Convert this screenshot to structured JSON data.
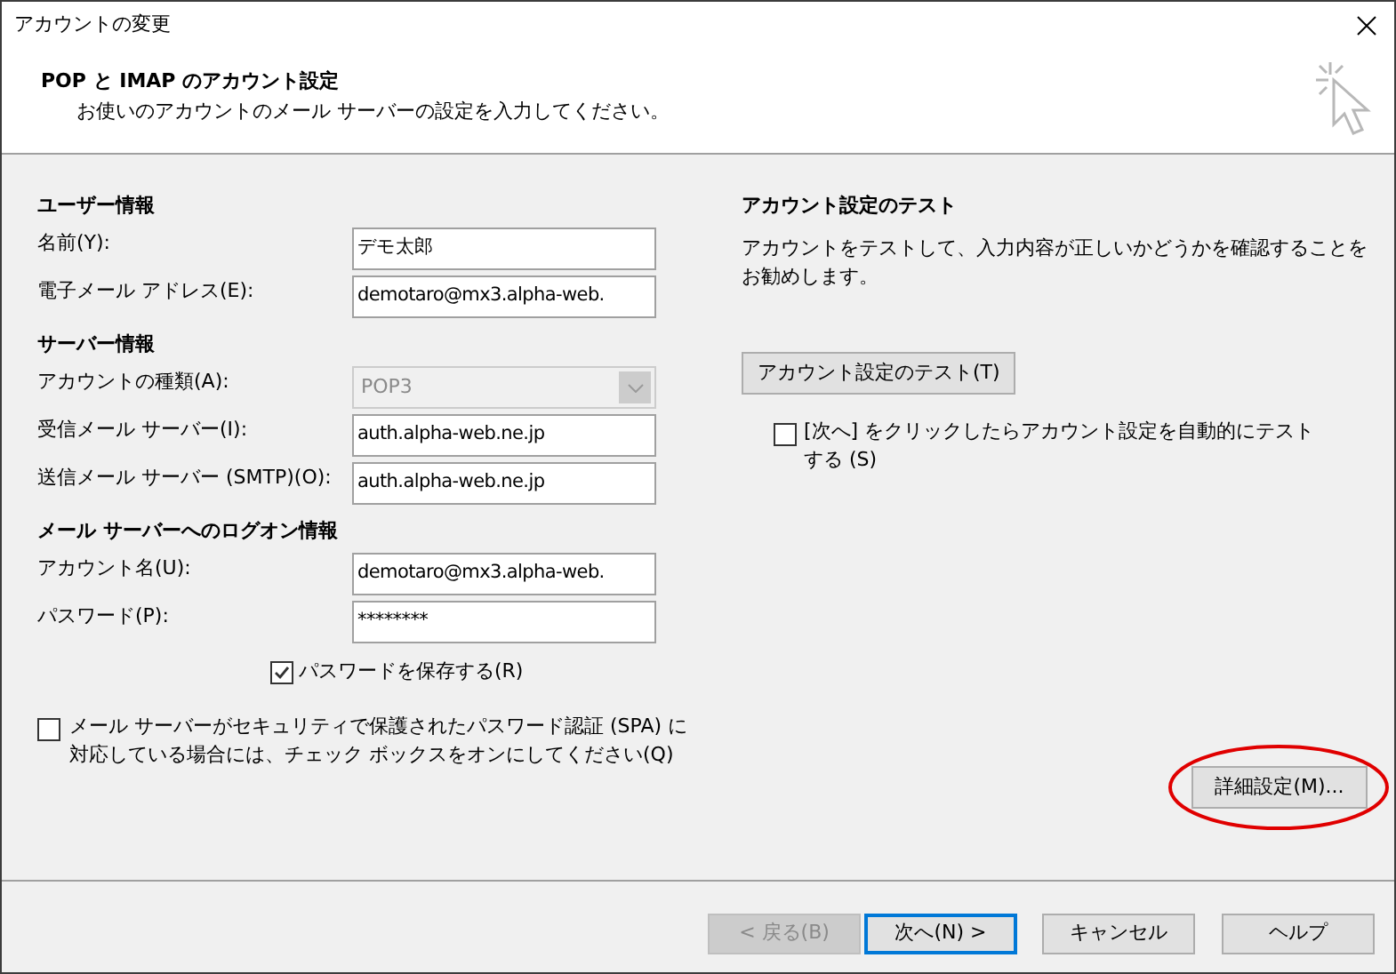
{
  "window": {
    "title": "アカウントの変更"
  },
  "header": {
    "title": "POP と IMAP のアカウント設定",
    "subtitle": "お使いのアカウントのメール サーバーの設定を入力してください。"
  },
  "sections": [
    {
      "title": "ユーザー情報",
      "fields": [
        {
          "kind": "text",
          "label": "名前(Y):",
          "value": "デモ太郎",
          "disabled": false
        },
        {
          "kind": "text",
          "label": "電子メール アドレス(E):",
          "value": "demotaro@mx3.alpha-web.",
          "disabled": false
        }
      ]
    },
    {
      "title": "サーバー情報",
      "fields": [
        {
          "kind": "select",
          "label": "アカウントの種類(A):",
          "value": "POP3",
          "disabled": true
        },
        {
          "kind": "text",
          "label": "受信メール サーバー(I):",
          "value": "auth.alpha-web.ne.jp",
          "disabled": false
        },
        {
          "kind": "text",
          "label": "送信メール サーバー (SMTP)(O):",
          "value": "auth.alpha-web.ne.jp",
          "disabled": false
        }
      ]
    },
    {
      "title": "メール サーバーへのログオン情報",
      "fields": [
        {
          "kind": "text",
          "label": "アカウント名(U):",
          "value": "demotaro@mx3.alpha-web.",
          "disabled": false
        },
        {
          "kind": "text",
          "label": "パスワード(P):",
          "value": "********",
          "disabled": false
        }
      ]
    }
  ],
  "save_password": {
    "label": "パスワードを保存する(R)",
    "checked": true
  },
  "spa": {
    "label": "メール サーバーがセキュリティで保護されたパスワード認証 (SPA) に対応している場合には、チェック ボックスをオンにしてください(Q)",
    "checked": false
  },
  "test": {
    "title": "アカウント設定のテスト",
    "description": "アカウントをテストして、入力内容が正しいかどうかを確認することをお勧めします。",
    "button": "アカウント設定のテスト(T)",
    "auto_test": {
      "label": "[次へ] をクリックしたらアカウント設定を自動的にテストする (S)",
      "checked": false
    }
  },
  "advanced_button": {
    "label": "詳細設定(M)...",
    "annotation": {
      "kind": "ellipse",
      "color": "#e00000"
    }
  },
  "footer_buttons": [
    {
      "label": "< 戻る(B)",
      "disabled": true,
      "default": false
    },
    {
      "label": "次へ(N) >",
      "disabled": false,
      "default": true
    },
    {
      "label": "キャンセル",
      "disabled": false,
      "default": false
    },
    {
      "label": "ヘルプ",
      "disabled": false,
      "default": false
    }
  ]
}
